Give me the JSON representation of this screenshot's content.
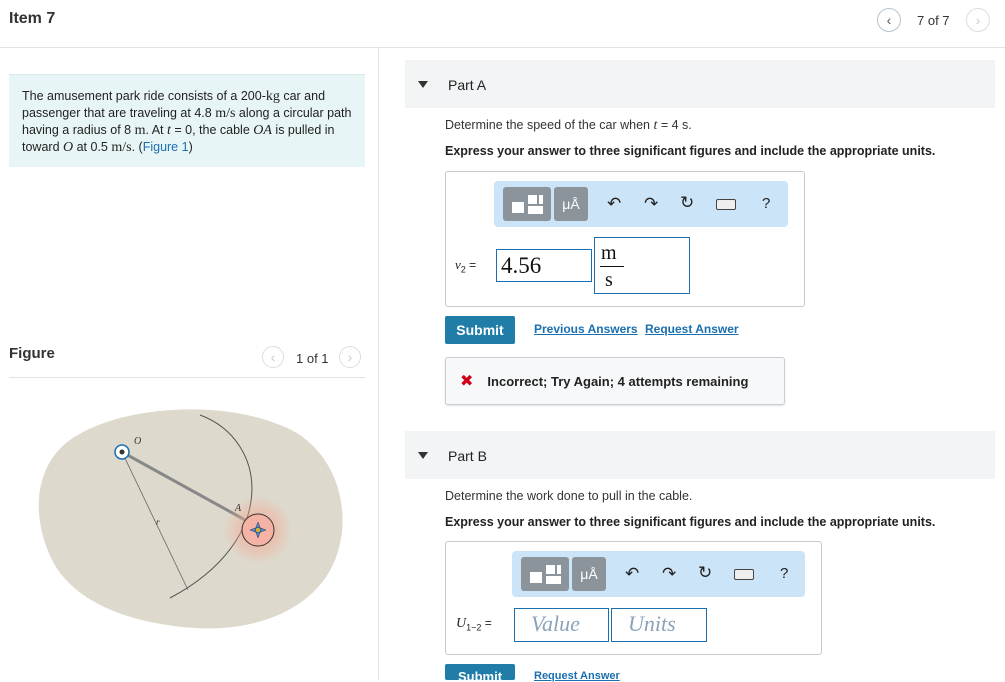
{
  "header": {
    "item_title": "Item 7",
    "counter": "7 of 7",
    "prev_icon": "chevron-left-icon",
    "next_icon": "chevron-right-icon"
  },
  "problem": {
    "t1": "The amusement park ride consists of a 200-",
    "kg": "kg",
    "t2": " car and passenger that are traveling at 4.8 ",
    "ms": "m/s",
    "t3": " along a circular path having a radius of 8 ",
    "m": "m",
    "t4": ". At ",
    "t_var": "t",
    "t5": " = 0, the cable ",
    "OA": "OA",
    "t6": " is pulled in toward ",
    "O": "O",
    "t7": " at 0.5 ",
    "ms2": "m/s",
    "t8": ". (",
    "figure_link": "Figure 1",
    "t9": ")"
  },
  "figure": {
    "heading": "Figure",
    "counter": "1 of 1",
    "labels": {
      "O": "O",
      "A": "A",
      "r": "r"
    }
  },
  "part_a": {
    "title": "Part A",
    "question_pre": "Determine the speed of the car when ",
    "question_t": "t",
    "question_post": " = 4 s.",
    "instruction": "Express your answer to three significant figures and include the appropriate units.",
    "toolbar": {
      "unit_label": "μÅ",
      "help": "?"
    },
    "var_label": "v",
    "var_sub": "2",
    "equals": " =",
    "value": "4.56",
    "unit_num": "m",
    "unit_den": "s",
    "submit": "Submit",
    "previous_answers": "Previous Answers",
    "request_answer": "Request Answer",
    "feedback": "Incorrect; Try Again; 4 attempts remaining"
  },
  "part_b": {
    "title": "Part B",
    "question": "Determine the work done to pull in the cable.",
    "instruction": "Express your answer to three significant figures and include the appropriate units.",
    "toolbar": {
      "unit_label": "μÅ",
      "help": "?"
    },
    "var_label": "U",
    "var_sub": "1−2",
    "equals": " =",
    "value_placeholder": "Value",
    "units_placeholder": "Units",
    "submit": "Submit",
    "request_answer": "Request Answer"
  },
  "colors": {
    "accent": "#1f7da8",
    "link": "#1a6fb0",
    "problem_bg": "#e8f5f6",
    "toolbar_bg": "#cce4f7",
    "error": "#d0021b"
  }
}
